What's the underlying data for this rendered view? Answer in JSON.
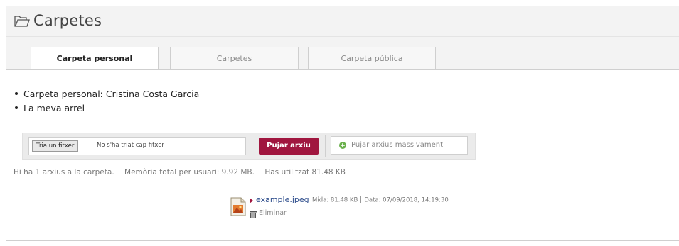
{
  "header": {
    "title": "Carpetes",
    "icon": "folder-open-icon"
  },
  "tabs": [
    {
      "label": "Carpeta personal",
      "active": true
    },
    {
      "label": "Carpetes",
      "active": false
    },
    {
      "label": "Carpeta pública",
      "active": false
    }
  ],
  "breadcrumbs": [
    "Carpeta personal: Cristina Costa Garcia",
    "La meva arrel"
  ],
  "upload": {
    "choose_label": "Tria un fitxer",
    "no_file_text": "No s'ha triat cap fitxer",
    "upload_label": "Pujar arxiu",
    "mass_upload_label": "Pujar arxius massivament",
    "mass_upload_icon": "plus-circle-icon"
  },
  "stats": {
    "count_text": "Hi ha 1 arxius a la carpeta.",
    "memory_text": "Memòria total per usuari: 9.92 MB.",
    "used_text": "Has utilitzat 81.48 KB"
  },
  "files": [
    {
      "name": "example.jpeg",
      "size": "Mida: 81.48 KB",
      "date": "Data: 07/09/2018, 14:19:30",
      "delete_label": "Eliminar",
      "thumb_icon": "image-file-icon"
    }
  ],
  "colors": {
    "accent": "#a0163f",
    "header_bg": "#f3f3f3",
    "link": "#2a4a8a"
  }
}
